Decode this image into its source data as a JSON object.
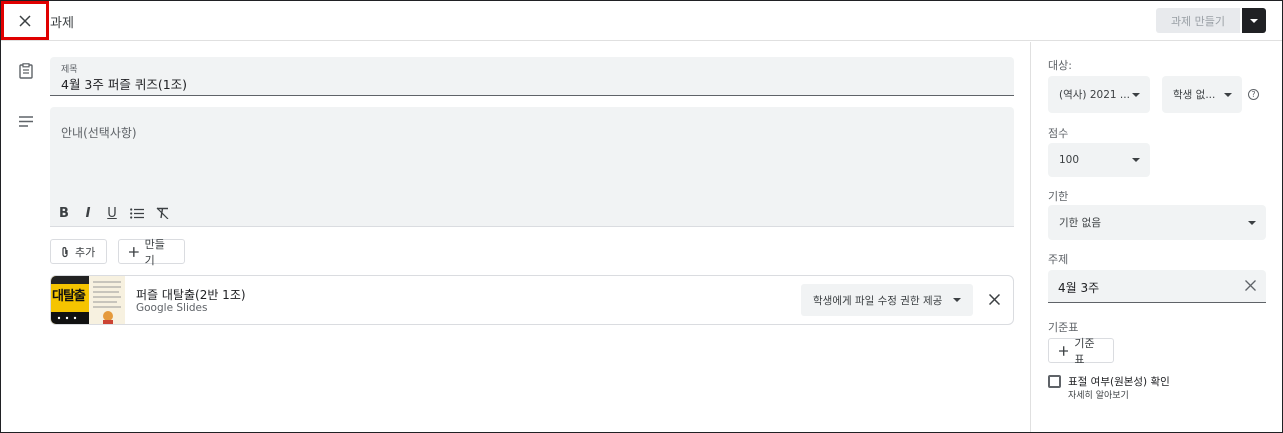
{
  "header": {
    "title": "과제",
    "create_label": "과제 만들기"
  },
  "form": {
    "title_label": "제목",
    "title_value": "4월 3주 퍼즐 퀴즈(1조)",
    "description_placeholder": "안내(선택사항)",
    "format_bold": "B",
    "format_italic": "I",
    "format_underline": "U",
    "add_label": "추가",
    "create_label": "만들기"
  },
  "attachment": {
    "name": "퍼즐 대탈출(2반 1조)",
    "type": "Google Slides",
    "thumbnail_text": "대탈출",
    "permission": "학생에게 파일 수정 권한 제공"
  },
  "panel": {
    "for_label": "대상:",
    "class_value": "(역사) 2021 ...",
    "students_value": "학생 없...",
    "help_glyph": "?",
    "points_label": "점수",
    "points_value": "100",
    "due_label": "기한",
    "due_value": "기한 없음",
    "topic_label": "주제",
    "topic_value": "4월 3주",
    "rubric_label": "기준표",
    "rubric_button": "기준표",
    "originality_label": "표절 여부(원본성) 확인",
    "learn_more": "자세히 알아보기"
  },
  "colors": {
    "accent_dark": "#202124",
    "field_bg": "#f1f3f4",
    "highlight_red": "#e00000"
  }
}
